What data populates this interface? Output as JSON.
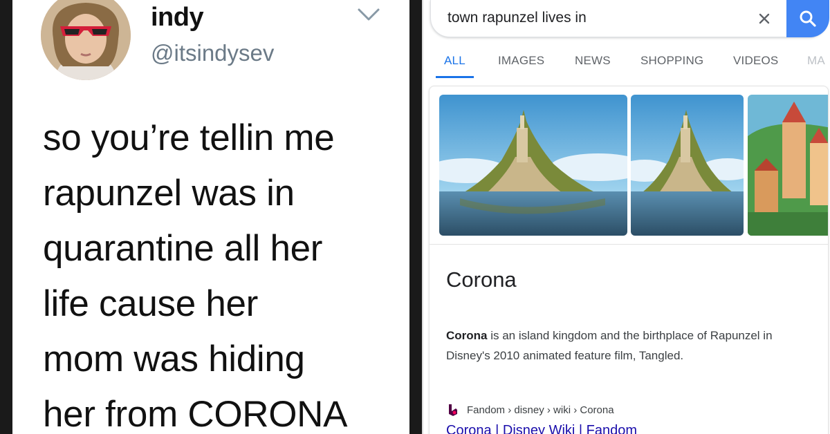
{
  "tweet": {
    "display_name": "indy",
    "handle": "@itsindysev",
    "lines": [
      "so you’re tellin me",
      "rapunzel was in",
      "quarantine all her",
      "life cause her",
      "mom was hiding",
      "her from CORONA"
    ],
    "menu_icon": "chevron-down-icon",
    "avatar_icon": "avatar"
  },
  "google": {
    "search": {
      "query": "town rapunzel lives in",
      "clear_icon": "close-icon",
      "search_icon": "search-icon"
    },
    "tabs": [
      "ALL",
      "IMAGES",
      "NEWS",
      "SHOPPING",
      "VIDEOS",
      "MA"
    ],
    "active_tab": "ALL",
    "colors": {
      "accent": "#1a73e8",
      "search_button": "#4285f4",
      "link": "#1a0dab"
    },
    "knowledge_panel": {
      "title": "Corona",
      "desc_bold": "Corona",
      "desc_rest": " is an island kingdom and the birthplace of Rapunzel in Disney's 2010 animated feature film, Tangled.",
      "source_site": "Fandom",
      "source_path": "› disney › wiki › Corona",
      "link_text": "Corona | Disney Wiki | Fandom"
    }
  }
}
